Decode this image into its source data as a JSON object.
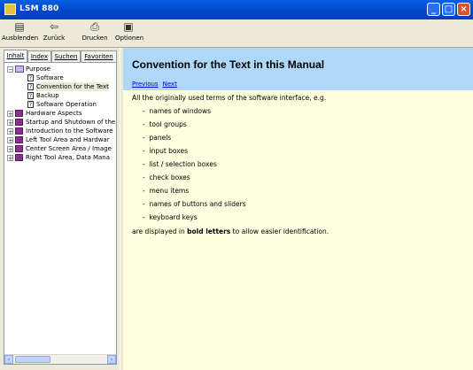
{
  "window": {
    "title": "LSM 880"
  },
  "toolbar": {
    "hide": "Ausblenden",
    "back": "Zurück",
    "print": "Drucken",
    "options": "Optionen"
  },
  "tabs": [
    "Inhalt",
    "Index",
    "Suchen",
    "Favoriten"
  ],
  "tree": {
    "root": "Purpose",
    "children": [
      "Software",
      "Convention for the Text",
      "Backup",
      "Software Operation"
    ],
    "books": [
      "Hardware Aspects",
      "Startup and Shutdown of the",
      "Introduction to the Software",
      "Left Tool Area and Hardwar",
      "Center Screen Area / Image",
      "Right Tool Area, Data Mana"
    ]
  },
  "content": {
    "title": "Convention for the Text in this Manual",
    "nav_previous": "Previous",
    "nav_next": "Next",
    "intro": "All the originally used terms of the software interface, e.g.",
    "items": [
      "names of windows",
      "tool groups",
      "panels",
      "input boxes",
      "list / selection boxes",
      "check boxes",
      "menu items",
      "names of buttons and sliders",
      "keyboard keys"
    ],
    "outro_pre": "are displayed in ",
    "outro_bold": "bold letters",
    "outro_post": " to allow easier identification."
  }
}
